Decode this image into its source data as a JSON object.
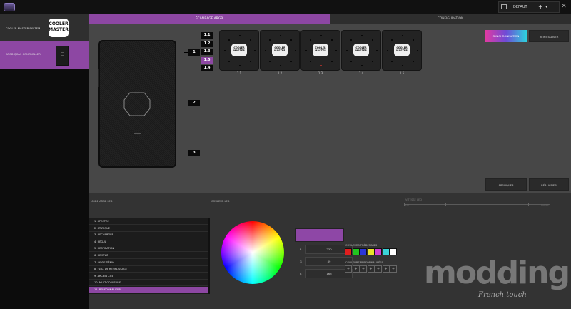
{
  "window": {
    "minimize": "—",
    "maximize": "▢",
    "close": "✕"
  },
  "profile": {
    "label": "DÉFAUT",
    "add": "+",
    "chevron": "▾"
  },
  "sidebar": {
    "system_label": "COOLER MASTER SYSTEM",
    "device_label": "ARGB QCAS CONTROLLER",
    "brand": {
      "line1": "COOLER",
      "line2": "MASTER"
    }
  },
  "tabs": [
    {
      "label": "ÉCLAIRAGE ARGB",
      "active": true
    },
    {
      "label": "CONFIGURATION",
      "active": false
    }
  ],
  "zones": {
    "fan_ports": [
      "1.1",
      "1.2",
      "1.3",
      "1.5",
      "1.4"
    ],
    "selected": "1.5",
    "case_zones": [
      "1",
      "2",
      "3"
    ]
  },
  "fans": [
    {
      "label": "1.1",
      "brand": "COOLER MASTER"
    },
    {
      "label": "1.2",
      "brand": "COOLER MASTER"
    },
    {
      "label": "1.3",
      "brand": "COOLER MASTER"
    },
    {
      "label": "1.4",
      "brand": "COOLER MASTER"
    },
    {
      "label": "1.5",
      "brand": "COOLER MASTER"
    }
  ],
  "buttons": {
    "sync": "SYNCHRONISATION",
    "reset": "RÉINITIALISER",
    "apply": "APPLIQUER",
    "realign": "RÉALIGNER"
  },
  "mode": {
    "header": "MODE ARGB LED",
    "items": [
      "1. SPECTRE",
      "2. STATIQUE",
      "3. RECHARGER",
      "4. RÉGUL",
      "5. RESPIRATION",
      "6. REMPLIR",
      "7. MODE DÉMO",
      "8. FLUX DE REMPLISSAGE",
      "9. ARC EN CIEL",
      "10. MULTICOULEURS",
      "11. PERSONNALISER"
    ],
    "selected_index": 10
  },
  "color": {
    "header": "COULEUR LED",
    "current_hex": "#8e47a6",
    "r_label": "R",
    "r_value": "230",
    "g_label": "G",
    "g_value": "89",
    "b_label": "B",
    "b_value": "163",
    "preset_label": "COULEURS PRÉDÉFINIES",
    "presets": [
      "#e01e1e",
      "#22c51f",
      "#2b36d8",
      "#e9e32a",
      "#d23fd4",
      "#3ad4d9",
      "#ffffff"
    ],
    "custom_label": "COULEURS PERSONNALISÉES",
    "custom_placeholder": "+",
    "custom_count": 7
  },
  "speed": {
    "label": "VITESSE LED",
    "min": "LENT",
    "max": "RAPIDE"
  },
  "watermark": {
    "main": "modding.fr",
    "sub": "French touch"
  }
}
